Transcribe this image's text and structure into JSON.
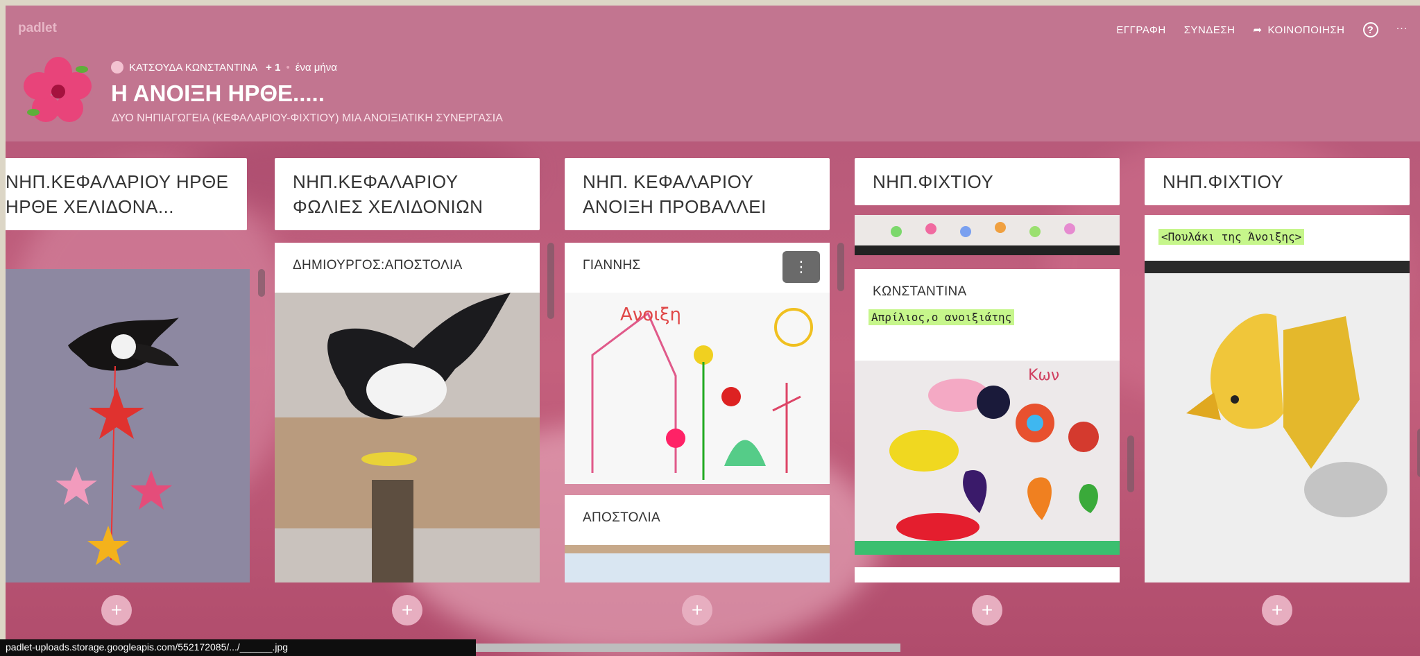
{
  "app": {
    "brand": "padlet"
  },
  "nav": {
    "signup": "ΕΓΓΡΑΦΗ",
    "login": "ΣΥΝΔΕΣΗ",
    "share": "ΚΟΙΝΟΠΟΙΗΣΗ",
    "help": "?",
    "more": "···"
  },
  "header": {
    "author": "ΚΑΤΣΟΥΔΑ ΚΩΝΣΤΑΝΤΙΝΑ",
    "collaborators": "+ 1",
    "separator": "•",
    "time": "ένα μήνα",
    "title": "Η ΑΝΟΙΞΗ ΗΡΘΕ.....",
    "subtitle": "ΔΥΟ ΝΗΠΙΑΓΩΓΕΙΑ (ΚΕΦΑΛΑΡΙΟΥ-ΦΙΧΤΙΟΥ) ΜΙΑ ΑΝΟΙΞΙΑΤΙΚΗ ΣΥΝΕΡΓΑΣΙΑ"
  },
  "columns": [
    {
      "title": "ΝΗΠ.ΚΕΦΑΛΑΡΙΟΥ ΗΡΘΕ ΗΡΘΕ ΧΕΛΙΔΟΝΑ..."
    },
    {
      "title": "ΝΗΠ.ΚΕΦΑΛΑΡΙΟΥ ΦΩΛΙΕΣ ΧΕΛΙΔΟΝΙΩΝ"
    },
    {
      "title": "ΝΗΠ. ΚΕΦΑΛΑΡΙΟΥ ΑΝΟΙΞΗ ΠΡΟΒΑΛΛΕΙ"
    },
    {
      "title": "ΝΗΠ.ΦΙΧΤΙΟΥ"
    },
    {
      "title": "ΝΗΠ.ΦΙΧΤΙΟΥ"
    }
  ],
  "cards": {
    "c2_author": "ΔΗΜΙΟΥΡΓΟΣ:ΑΠΟΣΤΟΛΙΑ",
    "c3_author": "ΓΙΑΝΝΗΣ",
    "c3_menu": "⋮",
    "c3_second": "ΑΠΟΣΤΟΛΙΑ",
    "c4_author": "ΚΩΝΣΤΑΝΤΙΝΑ",
    "c4_sub": "Απρίλιος,ο ανοιξιάτης",
    "c5_sub": "<Πουλάκι της Άνοιξης>",
    "drawing_text": "Ανοιξη",
    "drawing_text2": "Κων"
  },
  "add_label": "+",
  "status": {
    "url": "padlet-uploads.storage.googleapis.com/552172085/.../______.jpg"
  },
  "colors": {
    "header": "#c27590",
    "highlight": "#c6f68b",
    "add_button": "#e7aec0"
  }
}
